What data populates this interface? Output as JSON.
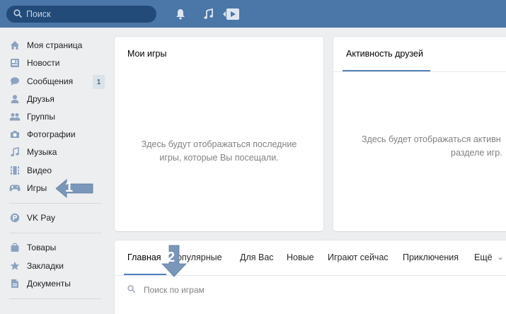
{
  "header": {
    "search_placeholder": "Поиск",
    "icons": [
      "search-icon",
      "bell-icon",
      "music-icon",
      "play-icon"
    ]
  },
  "sidebar": {
    "items": [
      {
        "label": "Моя страница",
        "icon": "home-icon"
      },
      {
        "label": "Новости",
        "icon": "news-icon"
      },
      {
        "label": "Сообщения",
        "icon": "message-icon",
        "badge": "1"
      },
      {
        "label": "Друзья",
        "icon": "friend-icon"
      },
      {
        "label": "Группы",
        "icon": "groups-icon"
      },
      {
        "label": "Фотографии",
        "icon": "camera-icon"
      },
      {
        "label": "Музыка",
        "icon": "music-icon"
      },
      {
        "label": "Видео",
        "icon": "video-icon"
      },
      {
        "label": "Игры",
        "icon": "gamepad-icon"
      }
    ],
    "items2": [
      {
        "label": "VK Pay",
        "icon": "vkpay-icon"
      }
    ],
    "items3": [
      {
        "label": "Товары",
        "icon": "bag-icon"
      },
      {
        "label": "Закладки",
        "icon": "star-icon"
      },
      {
        "label": "Документы",
        "icon": "document-icon"
      }
    ]
  },
  "my_games": {
    "title": "Мои игры",
    "empty_line1": "Здесь будут отображаться последние",
    "empty_line2": "игры, которые Вы посещали."
  },
  "friends_activity": {
    "title": "Активность друзей",
    "empty_line1": "Здесь будет отображаться активн",
    "empty_line2": "разделе игр."
  },
  "catalog": {
    "tabs": [
      "Главная",
      "Популярные",
      "Для Вас",
      "Новые",
      "Играют сейчас",
      "Приключения",
      "Ещё"
    ],
    "active_tab": "Главная",
    "search_placeholder": "Поиск по играм"
  },
  "annotations": {
    "marker1": "1",
    "marker2": "2"
  },
  "colors": {
    "header": "#4a76a8",
    "search_bg": "#224b7a",
    "accent": "#5181b8",
    "page_bg": "#edeef0",
    "arrow": "#7a96b8"
  }
}
